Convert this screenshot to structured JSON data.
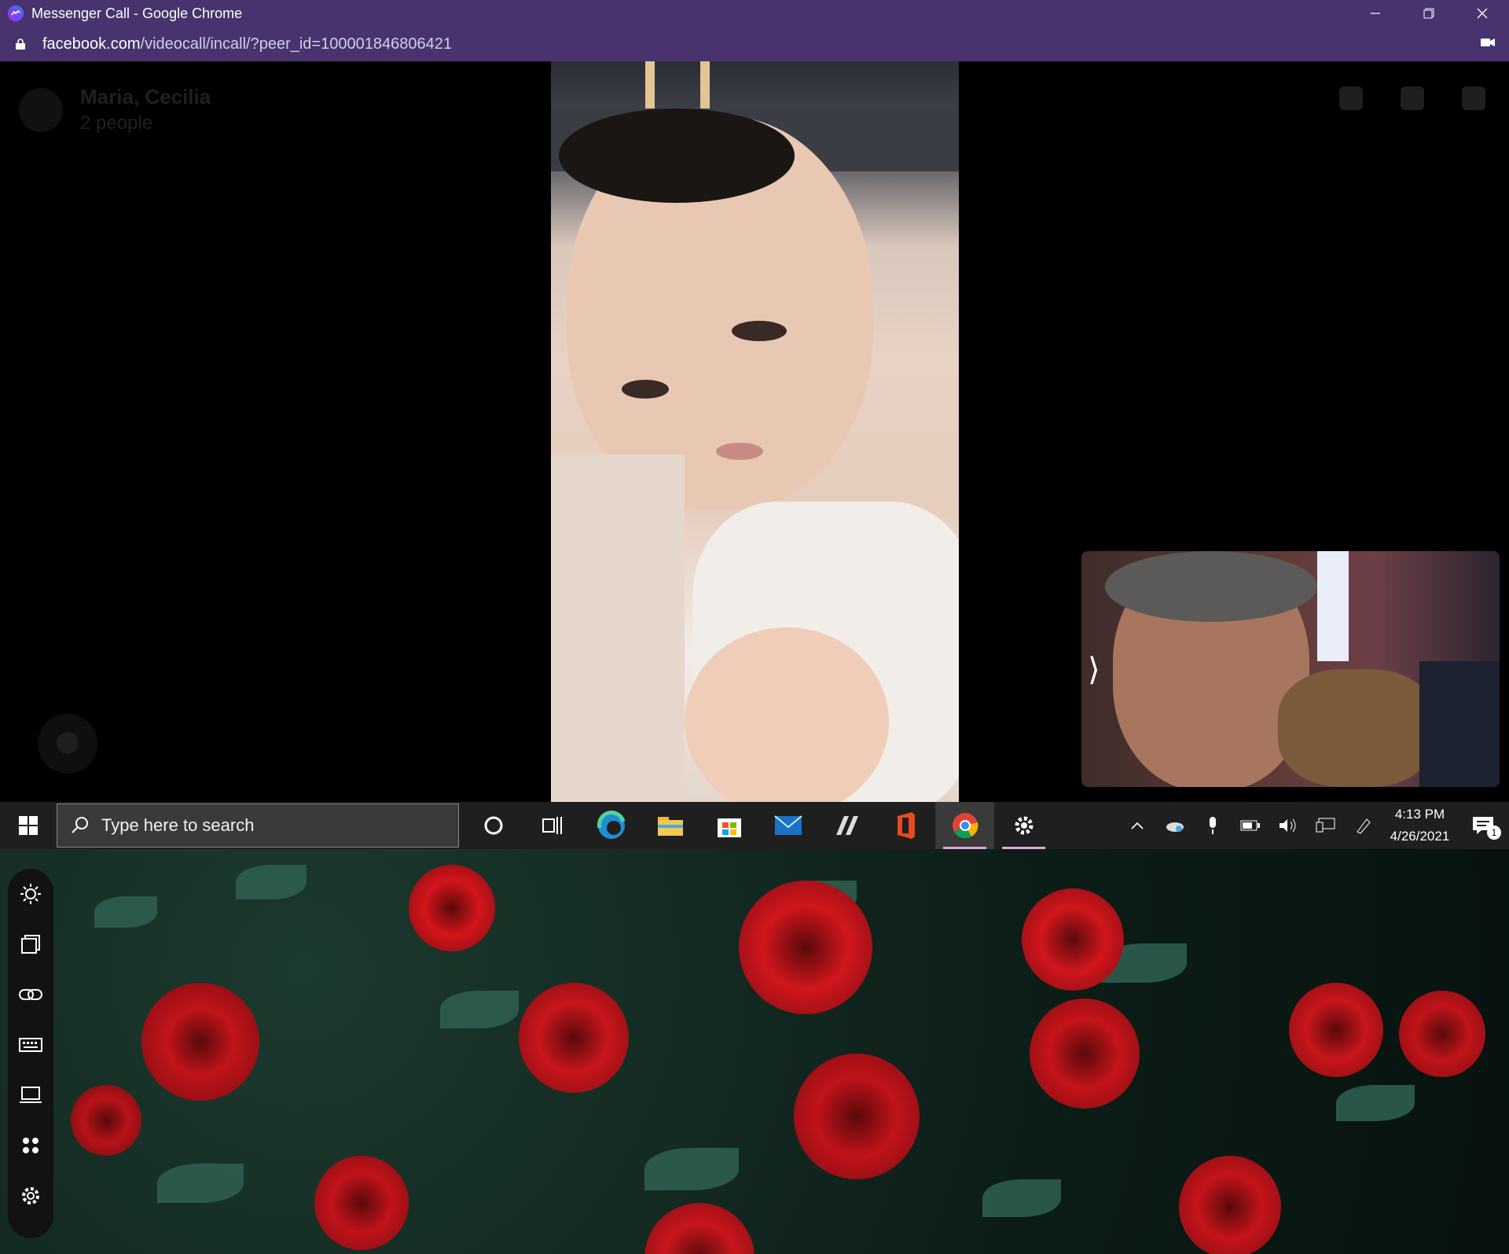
{
  "window": {
    "title": "Messenger Call - Google Chrome",
    "url_domain": "facebook.com",
    "url_path": "/videocall/incall/?peer_id=100001846806421",
    "accent": "#48336e"
  },
  "call": {
    "participant_names": "Maria, Cecilia",
    "participant_count": "2 people"
  },
  "taskbar": {
    "search_placeholder": "Type here to search",
    "apps": [
      "Cortana",
      "Task View",
      "Microsoft Edge",
      "File Explorer",
      "Microsoft Store",
      "Mail",
      "Unknown App",
      "Office",
      "Google Chrome",
      "Settings"
    ],
    "time": "4:13 PM",
    "date": "4/26/2021",
    "notification_count": "1"
  },
  "side_rail": {
    "icons": [
      "brightness-icon",
      "window-icon",
      "link-icon",
      "keyboard-icon",
      "laptop-icon",
      "apps-grid-icon",
      "settings-icon"
    ]
  }
}
